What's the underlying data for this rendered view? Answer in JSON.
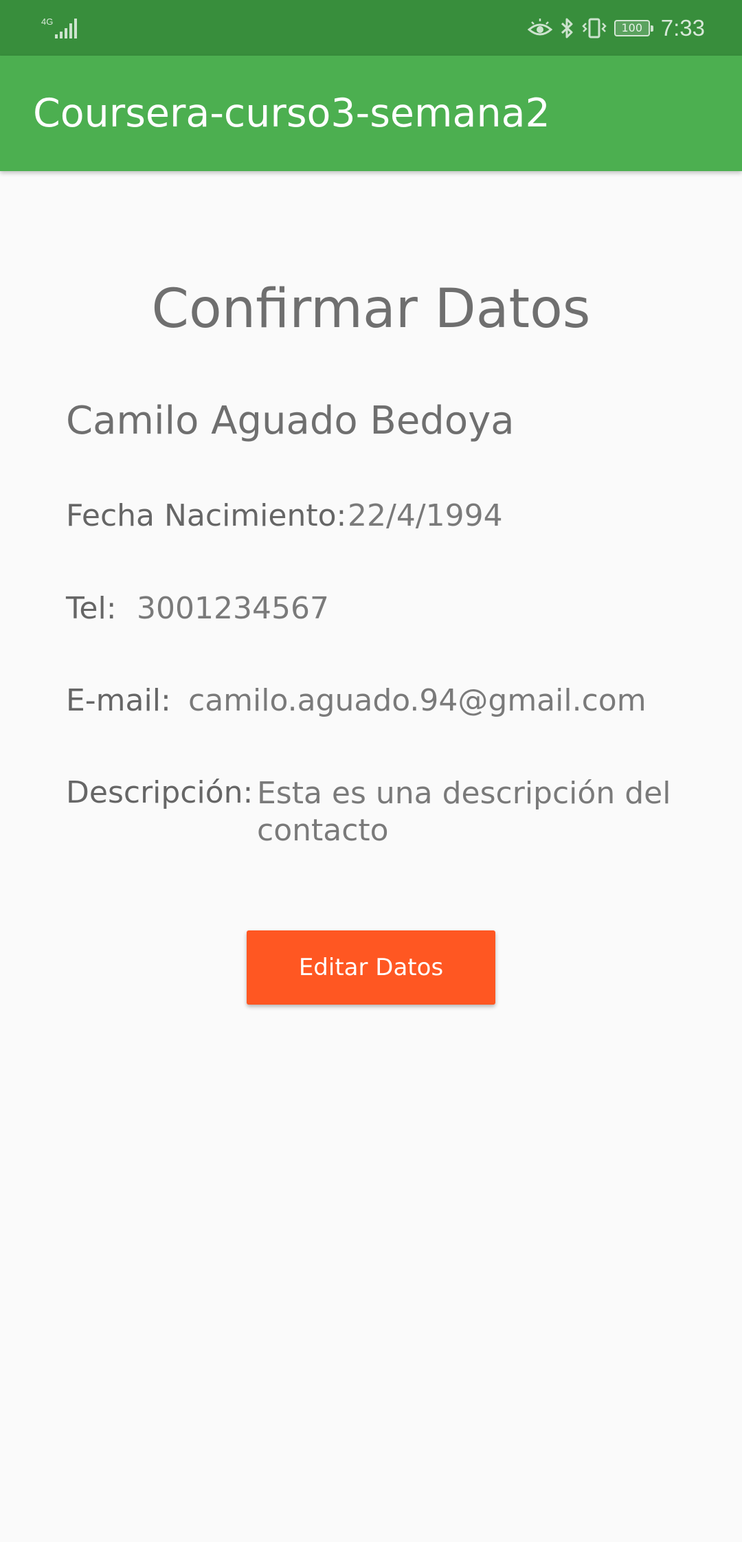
{
  "status_bar": {
    "network": "4G",
    "battery": "100",
    "time": "7:33",
    "icons": [
      "signal-icon",
      "eye-comfort-icon",
      "bluetooth-icon",
      "vibrate-icon",
      "battery-icon"
    ]
  },
  "app_bar": {
    "title": "Coursera-curso3-semana2",
    "color": "#4caf50"
  },
  "content": {
    "heading": "Confirmar Datos",
    "name": "Camilo Aguado Bedoya",
    "fields": {
      "birth": {
        "label": "Fecha Nacimiento:",
        "value": "22/4/1994"
      },
      "phone": {
        "label": "Tel:",
        "value": "3001234567"
      },
      "email": {
        "label": "E-mail:",
        "value": "camilo.aguado.94@gmail.com"
      },
      "description": {
        "label": "Descripción:",
        "value": "Esta es una descripción del contacto"
      }
    }
  },
  "edit_button": {
    "label": "Editar Datos",
    "color": "#ff5722"
  }
}
